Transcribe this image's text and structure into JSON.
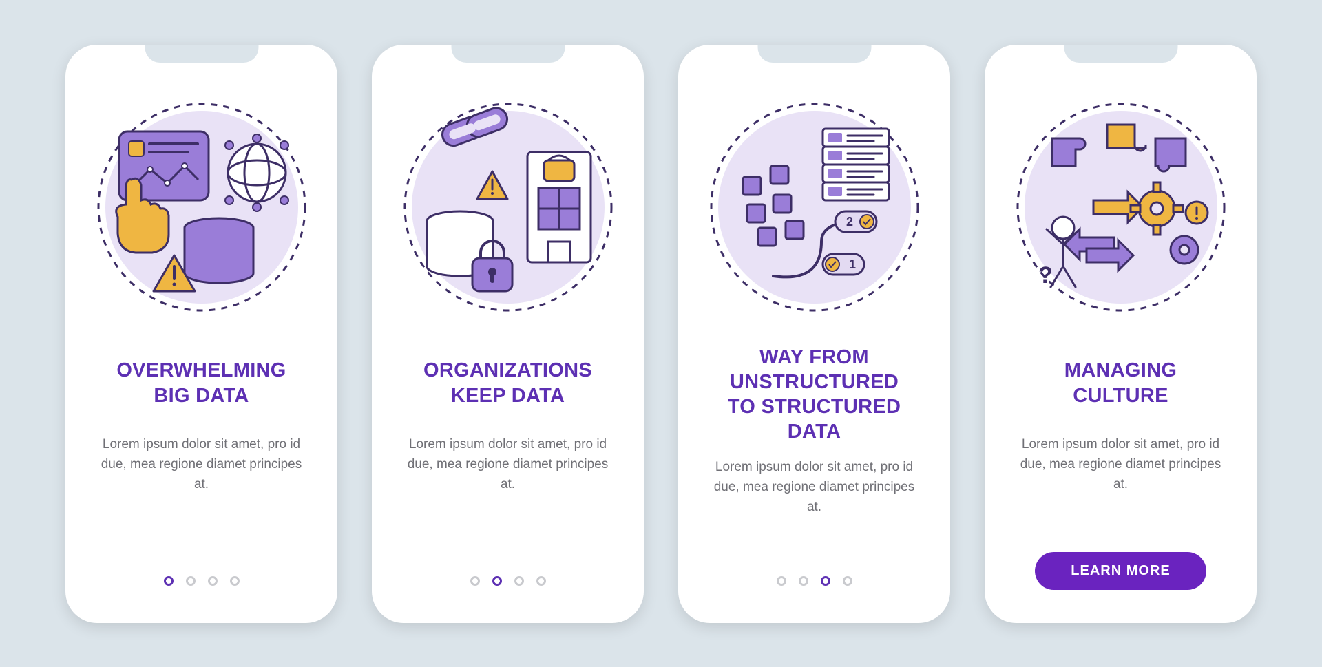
{
  "colors": {
    "background": "#dbe4ea",
    "card_bg": "#ffffff",
    "title": "#5d30b3",
    "desc": "#707076",
    "dot_active": "#5d30b3",
    "dot_inactive": "#c9cace",
    "cta_bg": "#6a23bf",
    "accent_purple": "#9a7dd8",
    "accent_purple_light": "#e9e2f6",
    "accent_yellow": "#efb642",
    "stroke": "#3d2e66"
  },
  "cards": [
    {
      "icon": "big-data-icon",
      "title": "Overwhelming\nBig Data",
      "desc": "Lorem ipsum dolor sit amet, pro id due, mea regione diamet principes at.",
      "pager": {
        "total": 4,
        "active": 0
      }
    },
    {
      "icon": "orgs-keep-data-icon",
      "title": "Organizations\nKeep Data",
      "desc": "Lorem ipsum dolor sit amet, pro id due, mea regione diamet principes at.",
      "pager": {
        "total": 4,
        "active": 1
      }
    },
    {
      "icon": "structured-data-icon",
      "title": "Way From\nUnstructured\nTo Structured Data",
      "desc": "Lorem ipsum dolor sit amet, pro id due, mea regione diamet principes at.",
      "pager": {
        "total": 4,
        "active": 2
      }
    },
    {
      "icon": "managing-culture-icon",
      "title": "Managing\nCulture",
      "desc": "Lorem ipsum dolor sit amet, pro id due, mea regione diamet principes at.",
      "cta": "LEARN MORE"
    }
  ]
}
